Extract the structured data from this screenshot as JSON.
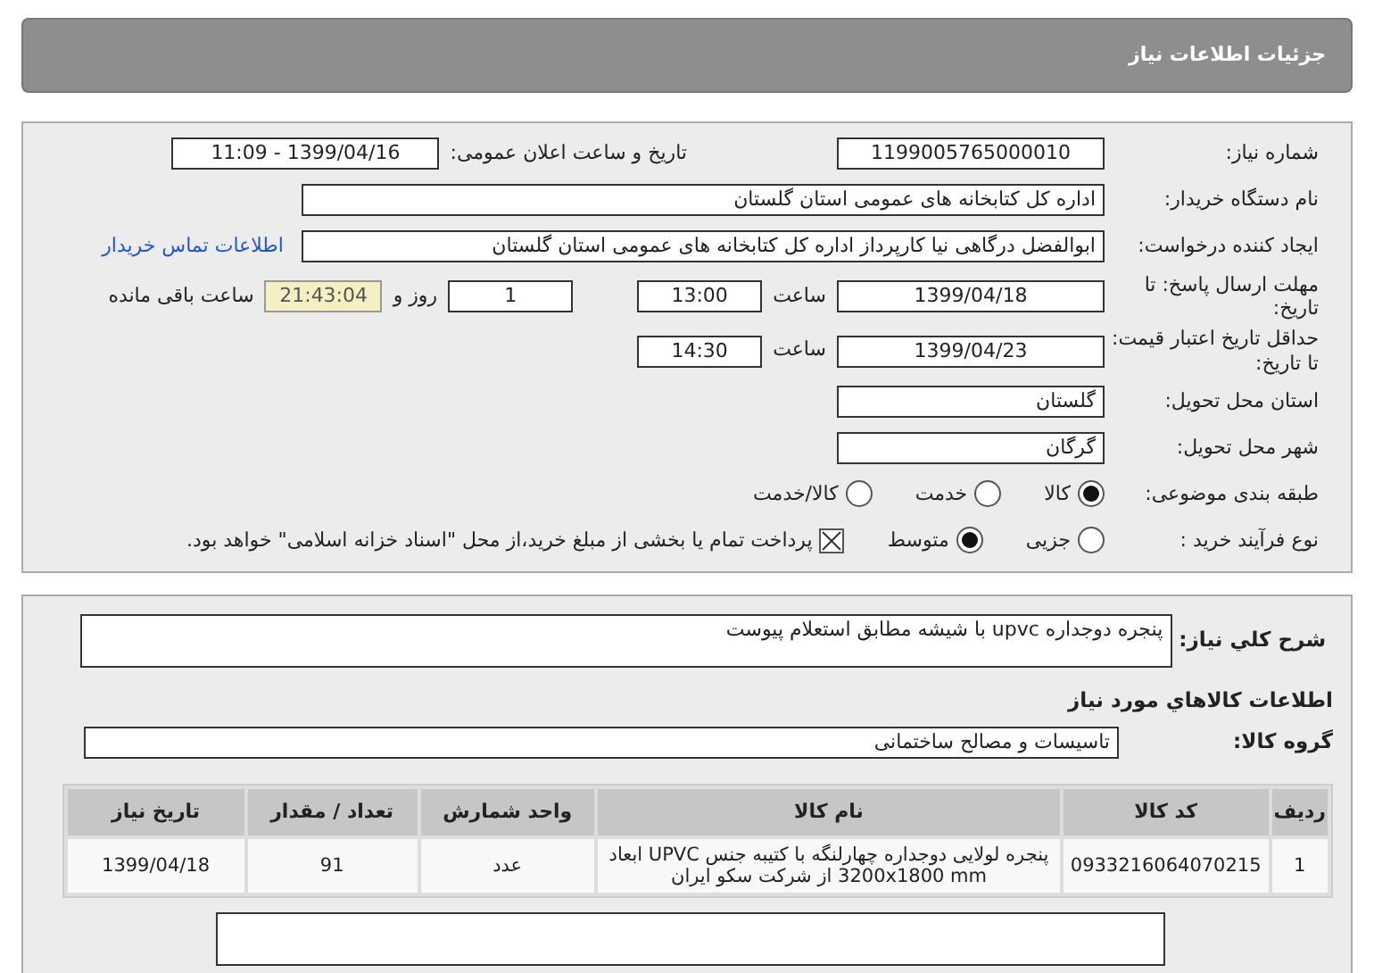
{
  "header": {
    "title": "جزئیات اطلاعات نیاز"
  },
  "need_number": {
    "label": "شماره نیاز:",
    "value": "1199005765000010"
  },
  "announce": {
    "label": "تاریخ و ساعت اعلان عمومی:",
    "value": "1399/04/16 - 11:09"
  },
  "buyer": {
    "label": "نام دستگاه خریدار:",
    "value": "اداره کل کتابخانه های عمومی استان گلستان"
  },
  "creator": {
    "label": "ایجاد کننده درخواست:",
    "value": "ابوالفضل  درگاهی نیا کارپرداز اداره کل کتابخانه های عمومی استان گلستان",
    "link": "اطلاعات تماس خریدار"
  },
  "deadline": {
    "label": "مهلت ارسال پاسخ: تا تاریخ:",
    "date": "1399/04/18",
    "time_label": "ساعت",
    "time": "13:00",
    "days": "1",
    "days_label": "روز و",
    "remaining": "21:43:04",
    "remaining_label": "ساعت باقی مانده"
  },
  "validity": {
    "label": "حداقل تاریخ اعتبار قیمت: تا تاریخ:",
    "date": "1399/04/23",
    "time_label": "ساعت",
    "time": "14:30"
  },
  "province": {
    "label": "استان محل تحویل:",
    "value": "گلستان"
  },
  "city": {
    "label": "شهر محل تحویل:",
    "value": "گرگان"
  },
  "category": {
    "label": "طبقه بندی موضوعی:",
    "options": [
      {
        "label": "کالا",
        "selected": true
      },
      {
        "label": "خدمت",
        "selected": false
      },
      {
        "label": "کالا/خدمت",
        "selected": false
      }
    ]
  },
  "process": {
    "label": "نوع فرآیند خرید :",
    "options": [
      {
        "label": "جزیی",
        "selected": false
      },
      {
        "label": "متوسط",
        "selected": true
      }
    ],
    "treasury": {
      "label": "پرداخت تمام یا بخشی از مبلغ خرید،از محل \"اسناد خزانه اسلامی\" خواهد بود.",
      "checked": true
    }
  },
  "description": {
    "label": "شرح كلي نياز:",
    "value": "پنجره دوجداره upvc  با شیشه مطابق استعلام پیوست"
  },
  "goods_title": "اطلاعات كالاهاي مورد نياز",
  "goods_group": {
    "label": "گروه کالا:",
    "value": "تاسیسات و مصالح ساختمانی"
  },
  "table": {
    "columns": [
      "ردیف",
      "کد کالا",
      "نام کالا",
      "واحد شمارش",
      "تعداد / مقدار",
      "تاریخ نیاز"
    ],
    "rows": [
      [
        "1",
        "0933216064070215",
        "پنجره لولایی دوجداره چهارلنگه با کتیبه جنس UPVC ابعاد 3200x1800 mm از شرکت سکو ایران",
        "عدد",
        "91",
        "1399/04/18"
      ]
    ]
  }
}
